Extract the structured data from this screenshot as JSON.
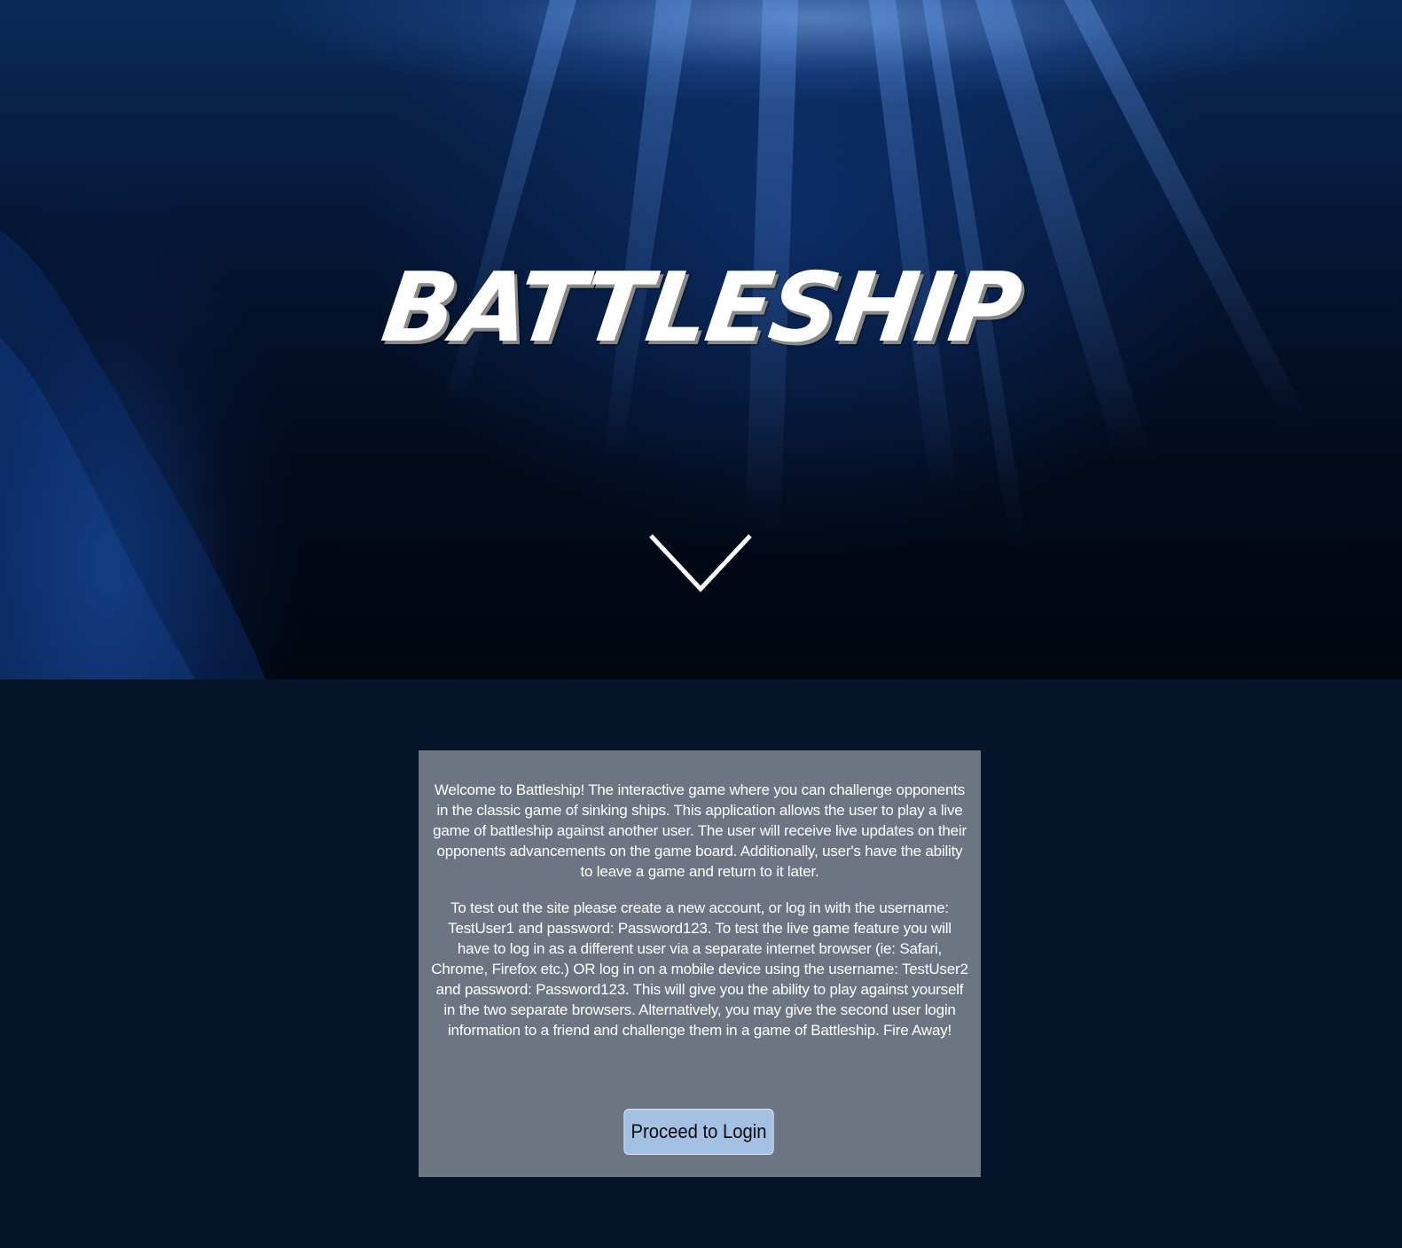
{
  "hero": {
    "title": "BATTLESHIP",
    "scroll_icon": "chevron-down-icon"
  },
  "intro": {
    "paragraph1": "Welcome to Battleship! The interactive game where you can challenge opponents in the classic game of sinking ships. This application allows the user to play a live game of battleship against another user. The user will receive live updates on their opponents advancements on the game board. Additionally, user's have the ability to leave a game and return to it later.",
    "paragraph2": "To test out the site please create a new account, or log in with the username: TestUser1 and password: Password123. To test the live game feature you will have to log in as a different user via a separate internet browser (ie: Safari, Chrome, Firefox etc.) OR log in on a mobile device using the username: TestUser2 and password: Password123. This will give you the ability to play against yourself in the two separate browsers. Alternatively, you may give the second user login information to a friend and challenge them in a game of Battleship. Fire Away!",
    "login_button_label": "Proceed to Login"
  },
  "colors": {
    "page_background": "#03142b",
    "card_background": "#6e7582",
    "button_background": "#a4c1e4"
  }
}
